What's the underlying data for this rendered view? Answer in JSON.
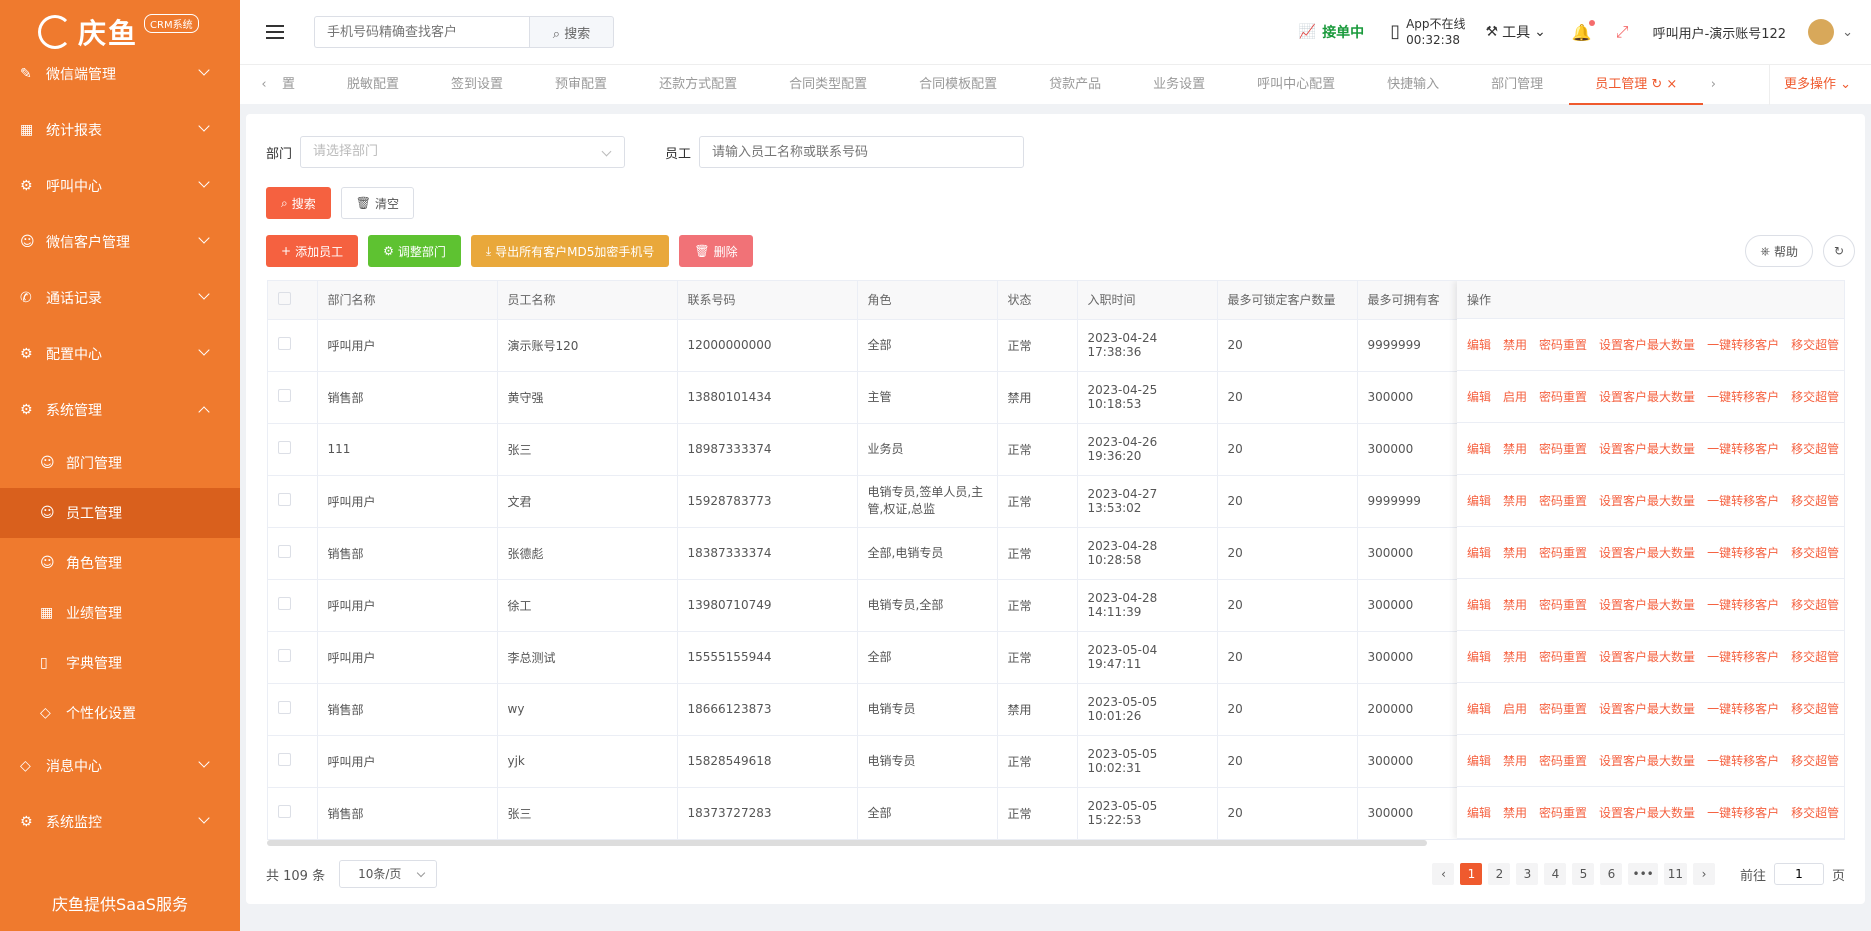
{
  "sidebar": {
    "logo_text": "庆鱼",
    "logo_badge": "CRM系统",
    "items": [
      {
        "label": "微信端管理"
      },
      {
        "label": "统计报表"
      },
      {
        "label": "呼叫中心"
      },
      {
        "label": "微信客户管理"
      },
      {
        "label": "通话记录"
      },
      {
        "label": "配置中心"
      },
      {
        "label": "系统管理"
      }
    ],
    "sub_items": [
      {
        "label": "部门管理"
      },
      {
        "label": "员工管理"
      },
      {
        "label": "角色管理"
      },
      {
        "label": "业绩管理"
      },
      {
        "label": "字典管理"
      },
      {
        "label": "个性化设置"
      }
    ],
    "bottom_items": [
      {
        "label": "消息中心"
      },
      {
        "label": "系统监控"
      }
    ],
    "footer": "庆鱼提供SaaS服务"
  },
  "header": {
    "search_placeholder": "手机号码精确查找客户",
    "search_button": "搜索",
    "accept_label": "接单中",
    "app_status": "App不在线",
    "app_timer": "00:32:38",
    "tools_label": "工具",
    "user_label": "呼叫用户-演示账号122"
  },
  "tabs": {
    "items": [
      "置",
      "脱敏配置",
      "签到设置",
      "预审配置",
      "还款方式配置",
      "合同类型配置",
      "合同模板配置",
      "贷款产品",
      "业务设置",
      "呼叫中心配置",
      "快捷输入",
      "部门管理",
      "员工管理"
    ],
    "active": "员工管理",
    "more": "更多操作"
  },
  "filter": {
    "dept_label": "部门",
    "dept_placeholder": "请选择部门",
    "emp_label": "员工",
    "emp_placeholder": "请输入员工名称或联系号码",
    "search_btn": "搜索",
    "clear_btn": "清空"
  },
  "actions": {
    "add": "添加员工",
    "adjust": "调整部门",
    "export": "导出所有客户MD5加密手机号",
    "delete": "删除",
    "help": "帮助"
  },
  "table": {
    "headers": [
      "部门名称",
      "员工名称",
      "联系号码",
      "角色",
      "状态",
      "入职时间",
      "最多可锁定客户数量",
      "最多可拥有客"
    ],
    "ops_header": "操作",
    "rows": [
      [
        "呼叫用户",
        "演示账号120",
        "12000000000",
        "全部",
        "正常",
        "2023-04-24 17:38:36",
        "20",
        "9999999"
      ],
      [
        "销售部",
        "黄守强",
        "13880101434",
        "主管",
        "禁用",
        "2023-04-25 10:18:53",
        "20",
        "300000"
      ],
      [
        "111",
        "张三",
        "18987333374",
        "业务员",
        "正常",
        "2023-04-26 19:36:20",
        "20",
        "300000"
      ],
      [
        "呼叫用户",
        "文君",
        "15928783773",
        "电销专员,签单人员,主管,权证,总监",
        "正常",
        "2023-04-27 13:53:02",
        "20",
        "9999999"
      ],
      [
        "销售部",
        "张德彪",
        "18387333374",
        "全部,电销专员",
        "正常",
        "2023-04-28 10:28:58",
        "20",
        "300000"
      ],
      [
        "呼叫用户",
        "徐工",
        "13980710749",
        "电销专员,全部",
        "正常",
        "2023-04-28 14:11:39",
        "20",
        "300000"
      ],
      [
        "呼叫用户",
        "李总测试",
        "15555155944",
        "全部",
        "正常",
        "2023-05-04 19:47:11",
        "20",
        "300000"
      ],
      [
        "销售部",
        "wy",
        "18666123873",
        "电销专员",
        "禁用",
        "2023-05-05 10:01:26",
        "20",
        "200000"
      ],
      [
        "呼叫用户",
        "yjk",
        "15828549618",
        "电销专员",
        "正常",
        "2023-05-05 10:02:31",
        "20",
        "300000"
      ],
      [
        "销售部",
        "张三",
        "18373727283",
        "全部",
        "正常",
        "2023-05-05 15:22:53",
        "20",
        "300000"
      ]
    ],
    "ops": [
      [
        "编辑",
        "禁用",
        "密码重置",
        "设置客户最大数量",
        "一键转移客户",
        "移交超管"
      ],
      [
        "编辑",
        "启用",
        "密码重置",
        "设置客户最大数量",
        "一键转移客户",
        "移交超管"
      ],
      [
        "编辑",
        "禁用",
        "密码重置",
        "设置客户最大数量",
        "一键转移客户",
        "移交超管"
      ],
      [
        "编辑",
        "禁用",
        "密码重置",
        "设置客户最大数量",
        "一键转移客户",
        "移交超管"
      ],
      [
        "编辑",
        "禁用",
        "密码重置",
        "设置客户最大数量",
        "一键转移客户",
        "移交超管"
      ],
      [
        "编辑",
        "禁用",
        "密码重置",
        "设置客户最大数量",
        "一键转移客户",
        "移交超管"
      ],
      [
        "编辑",
        "禁用",
        "密码重置",
        "设置客户最大数量",
        "一键转移客户",
        "移交超管"
      ],
      [
        "编辑",
        "启用",
        "密码重置",
        "设置客户最大数量",
        "一键转移客户",
        "移交超管"
      ],
      [
        "编辑",
        "禁用",
        "密码重置",
        "设置客户最大数量",
        "一键转移客户",
        "移交超管"
      ],
      [
        "编辑",
        "禁用",
        "密码重置",
        "设置客户最大数量",
        "一键转移客户",
        "移交超管"
      ]
    ]
  },
  "pagination": {
    "total": "共 109 条",
    "page_size": "10条/页",
    "pages": [
      "1",
      "2",
      "3",
      "4",
      "5",
      "6",
      "•••",
      "11"
    ],
    "current": "1",
    "goto_label": "前往",
    "goto_value": "1",
    "page_suffix": "页"
  },
  "colors": {
    "sidebar": "#ef7a2e",
    "accent": "#ef5a2e",
    "green": "#5ec231"
  }
}
